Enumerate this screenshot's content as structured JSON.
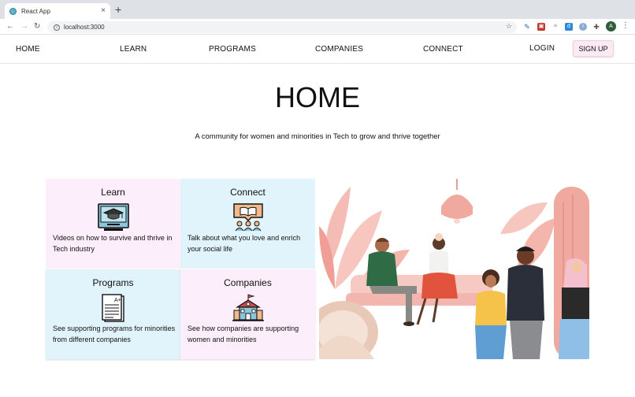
{
  "browser": {
    "tab_title": "React App",
    "tab_close": "×",
    "new_tab": "+",
    "url": "localhost:3000",
    "profile_initial": "A"
  },
  "nav": {
    "home": "HOME",
    "learn": "LEARN",
    "programs": "PROGRAMS",
    "companies": "COMPANIES",
    "connect": "CONNECT",
    "login": "LOGIN",
    "signup": "SIGN UP"
  },
  "hero": {
    "title": "HOME",
    "tagline": "A community for women and minorities in Tech to grow and thrive together"
  },
  "cards": [
    {
      "title": "Learn",
      "text": "Videos on how to survive and thrive in Tech industry",
      "icon": "graduation-cap-monitor-icon"
    },
    {
      "title": "Connect",
      "text": "Talk about what you love and enrich your social life",
      "icon": "community-book-icon"
    },
    {
      "title": "Programs",
      "text": "See supporting programs for minorities from different companies",
      "icon": "graded-document-icon"
    },
    {
      "title": "Companies",
      "text": "See how companies are supporting women and minorities",
      "icon": "school-building-icon"
    }
  ],
  "colors": {
    "pink_card": "#fceefa",
    "blue_card": "#e2f4fb",
    "signup_bg": "#fbe9f4",
    "illustration_pink": "#f3b6ae"
  }
}
